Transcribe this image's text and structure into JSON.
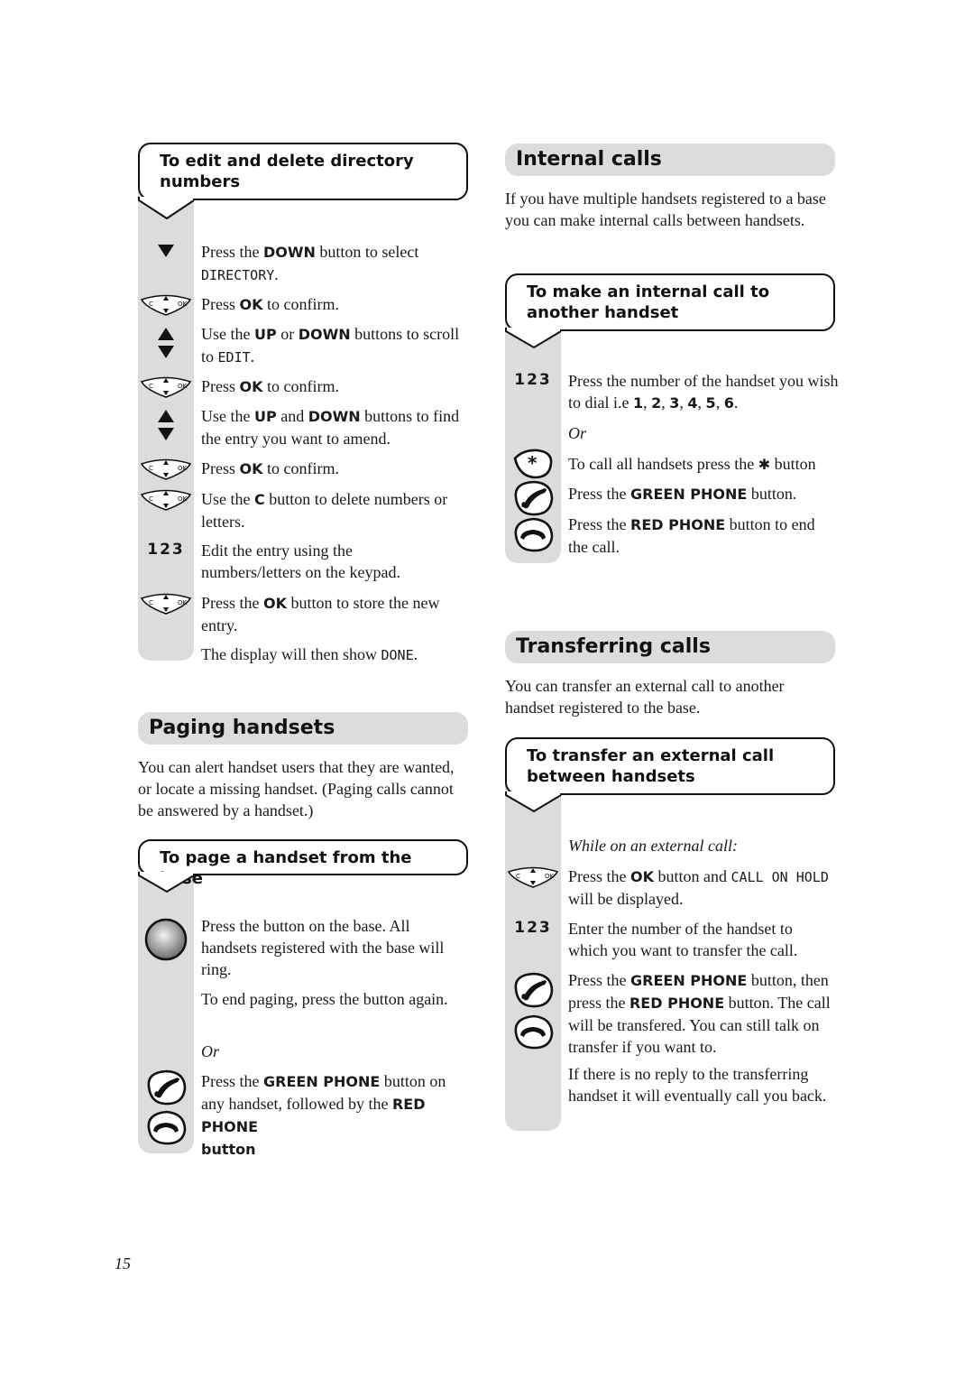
{
  "page_number": "15",
  "left": {
    "edit_callout": {
      "title": "To edit and delete directory numbers",
      "steps": [
        {
          "icon": "down-arrow-icon",
          "parts": [
            "Press the ",
            "DOWN",
            " button to select ",
            "DIRECTORY",
            "."
          ]
        },
        {
          "icon": "nav-key-icon",
          "parts": [
            "Press ",
            "OK",
            " to confirm."
          ]
        },
        {
          "icon": "up-down-arrows-icon",
          "parts": [
            "Use the ",
            "UP",
            " or ",
            "DOWN",
            " buttons to scroll to ",
            "EDIT",
            "."
          ]
        },
        {
          "icon": "nav-key-icon",
          "parts": [
            "Press ",
            "OK",
            " to confirm."
          ]
        },
        {
          "icon": "up-down-arrows-icon",
          "parts": [
            "Use the ",
            "UP",
            " and ",
            "DOWN",
            " buttons to find the entry you want to amend."
          ]
        },
        {
          "icon": "nav-key-icon",
          "parts": [
            "Press ",
            "OK",
            " to confirm."
          ]
        },
        {
          "icon": "nav-key-icon",
          "parts": [
            "Use the ",
            "C",
            " button to delete numbers or letters."
          ]
        },
        {
          "icon": "keypad-123-icon",
          "icon_text": "123",
          "parts": [
            "Edit the entry using the numbers/letters on the keypad."
          ]
        },
        {
          "icon": "nav-key-icon",
          "parts": [
            "Press the ",
            "OK",
            " button to store the new entry."
          ]
        },
        {
          "icon": "",
          "parts": [
            "The display will then show ",
            "DONE",
            "."
          ]
        }
      ]
    },
    "paging": {
      "heading": "Paging handsets",
      "intro": "You can alert handset users that they are wanted, or locate a missing handset. (Paging calls cannot be answered by a handset.)",
      "callout_title": "To page a handset from the base",
      "step1": "Press the button on the base. All handsets registered with the base will ring.",
      "step2": "To end paging, press the button again.",
      "or": "Or",
      "step3_parts": [
        "Press the ",
        "GREEN PHONE",
        " button on any handset, followed by the ",
        "RED PHONE",
        " button"
      ]
    }
  },
  "right": {
    "internal": {
      "heading": "Internal calls",
      "intro": "If you have multiple handsets registered to a base you can make internal calls between handsets.",
      "callout_title": "To make an internal call to another handset",
      "icon_text": "123",
      "step1_parts": [
        "Press the number of the handset you wish to dial i.e ",
        "1",
        ", ",
        "2",
        ", ",
        "3",
        ", ",
        "4",
        ", ",
        "5",
        ", ",
        "6",
        "."
      ],
      "or": "Or",
      "step2_parts": [
        "To call all handsets press the ",
        "✱",
        " button"
      ],
      "step3_parts": [
        "Press the ",
        "GREEN PHONE",
        " button."
      ],
      "step4_parts": [
        "Press the ",
        "RED PHONE",
        " button to end the call."
      ]
    },
    "transfer": {
      "heading": "Transferring calls",
      "intro": "You can transfer an external call to another handset registered to the base.",
      "callout_title": "To transfer an external call between handsets",
      "lead": "While on an external call:",
      "step1_parts": [
        "Press the ",
        "OK",
        " button and ",
        "CALL ON HOLD",
        " will be displayed."
      ],
      "icon_text": "123",
      "step2": "Enter the number of the handset to which you want to transfer the call.",
      "step3_parts": [
        "Press the ",
        "GREEN PHONE",
        " button, then press the ",
        "RED PHONE",
        " button. The call will be transfered. You can still talk on transfer if you want to."
      ],
      "step4": "If there is no reply to the transferring handset it will eventually call you back."
    }
  }
}
